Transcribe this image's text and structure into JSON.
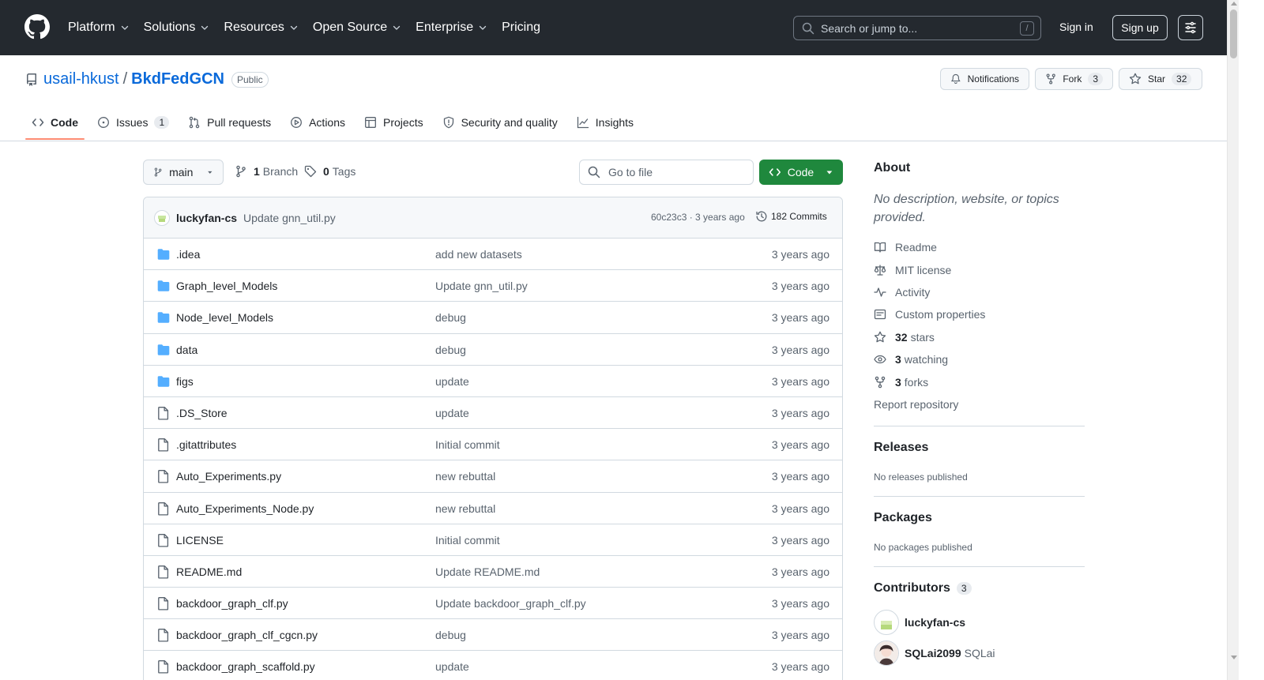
{
  "header": {
    "nav": [
      {
        "label": "Platform",
        "dropdown": true
      },
      {
        "label": "Solutions",
        "dropdown": true
      },
      {
        "label": "Resources",
        "dropdown": true
      },
      {
        "label": "Open Source",
        "dropdown": true
      },
      {
        "label": "Enterprise",
        "dropdown": true
      },
      {
        "label": "Pricing",
        "dropdown": false
      }
    ],
    "search_placeholder": "Search or jump to...",
    "search_shortcut": "/",
    "signin": "Sign in",
    "signup": "Sign up"
  },
  "repo": {
    "owner": "usail-hkust",
    "separator": "/",
    "name": "BkdFedGCN",
    "visibility": "Public",
    "notifications_label": "Notifications",
    "fork_label": "Fork",
    "fork_count": "3",
    "star_label": "Star",
    "star_count": "32"
  },
  "tabs": [
    {
      "label": "Code",
      "icon": "code-icon",
      "active": true,
      "counter": ""
    },
    {
      "label": "Issues",
      "icon": "issue-icon",
      "active": false,
      "counter": "1"
    },
    {
      "label": "Pull requests",
      "icon": "pull-request-icon",
      "active": false,
      "counter": ""
    },
    {
      "label": "Actions",
      "icon": "play-icon",
      "active": false,
      "counter": ""
    },
    {
      "label": "Projects",
      "icon": "table-icon",
      "active": false,
      "counter": ""
    },
    {
      "label": "Security and quality",
      "icon": "shield-icon",
      "active": false,
      "counter": ""
    },
    {
      "label": "Insights",
      "icon": "graph-icon",
      "active": false,
      "counter": ""
    }
  ],
  "branchbar": {
    "branch": "main",
    "branch_count": "1",
    "branch_label": "Branch",
    "tag_count": "0",
    "tag_label": "Tags",
    "goto_placeholder": "Go to file",
    "code_button": "Code"
  },
  "latest_commit": {
    "author": "luckyfan-cs",
    "message": "Update gnn_util.py",
    "meta": "60c23c3 · 3 years ago",
    "count_label": "182 Commits"
  },
  "files": [
    {
      "type": "dir",
      "name": ".idea",
      "message": "add new datasets",
      "date": "3 years ago"
    },
    {
      "type": "dir",
      "name": "Graph_level_Models",
      "message": "Update gnn_util.py",
      "date": "3 years ago"
    },
    {
      "type": "dir",
      "name": "Node_level_Models",
      "message": "debug",
      "date": "3 years ago"
    },
    {
      "type": "dir",
      "name": "data",
      "message": "debug",
      "date": "3 years ago"
    },
    {
      "type": "dir",
      "name": "figs",
      "message": "update",
      "date": "3 years ago"
    },
    {
      "type": "file",
      "name": ".DS_Store",
      "message": "update",
      "date": "3 years ago"
    },
    {
      "type": "file",
      "name": ".gitattributes",
      "message": "Initial commit",
      "date": "3 years ago"
    },
    {
      "type": "file",
      "name": "Auto_Experiments.py",
      "message": "new rebuttal",
      "date": "3 years ago"
    },
    {
      "type": "file",
      "name": "Auto_Experiments_Node.py",
      "message": "new rebuttal",
      "date": "3 years ago"
    },
    {
      "type": "file",
      "name": "LICENSE",
      "message": "Initial commit",
      "date": "3 years ago"
    },
    {
      "type": "file",
      "name": "README.md",
      "message": "Update README.md",
      "date": "3 years ago"
    },
    {
      "type": "file",
      "name": "backdoor_graph_clf.py",
      "message": "Update backdoor_graph_clf.py",
      "date": "3 years ago"
    },
    {
      "type": "file",
      "name": "backdoor_graph_clf_cgcn.py",
      "message": "debug",
      "date": "3 years ago"
    },
    {
      "type": "file",
      "name": "backdoor_graph_scaffold.py",
      "message": "update",
      "date": "3 years ago"
    }
  ],
  "sidebar": {
    "about_title": "About",
    "about_desc": "No description, website, or topics provided.",
    "links": [
      {
        "icon": "book-icon",
        "bold": "",
        "label": "Readme"
      },
      {
        "icon": "law-icon",
        "bold": "",
        "label": "MIT license"
      },
      {
        "icon": "pulse-icon",
        "bold": "",
        "label": "Activity"
      },
      {
        "icon": "note-icon",
        "bold": "",
        "label": "Custom properties"
      },
      {
        "icon": "star-icon",
        "bold": "32",
        "label": "stars"
      },
      {
        "icon": "eye-icon",
        "bold": "3",
        "label": "watching"
      },
      {
        "icon": "fork-icon",
        "bold": "3",
        "label": "forks"
      }
    ],
    "report": "Report repository",
    "releases_title": "Releases",
    "releases_text": "No releases published",
    "packages_title": "Packages",
    "packages_text": "No packages published",
    "contributors_title": "Contributors",
    "contributors_count": "3",
    "contributors": [
      {
        "login": "luckyfan-cs",
        "name": ""
      },
      {
        "login": "SQLai2099",
        "name": "SQLai"
      }
    ]
  },
  "colors": {
    "header_bg": "#24292f",
    "link": "#0969da",
    "green": "#1f883d",
    "folder": "#54aeff",
    "tab_underline": "#fd8c73"
  }
}
